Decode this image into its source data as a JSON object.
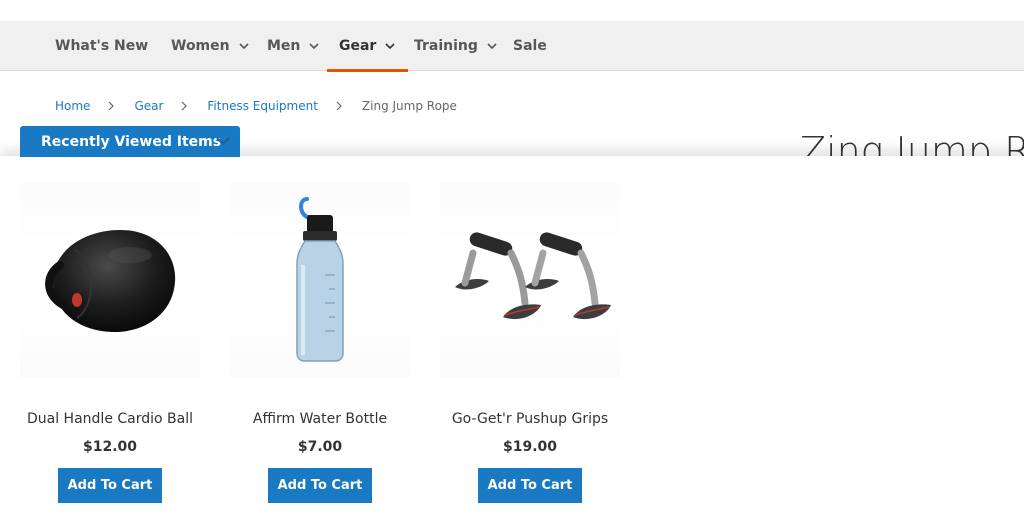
{
  "nav": {
    "items": [
      {
        "label": "What's New",
        "has_dropdown": false,
        "active": false
      },
      {
        "label": "Women",
        "has_dropdown": true,
        "active": false
      },
      {
        "label": "Men",
        "has_dropdown": true,
        "active": false
      },
      {
        "label": "Gear",
        "has_dropdown": true,
        "active": true
      },
      {
        "label": "Training",
        "has_dropdown": true,
        "active": false
      },
      {
        "label": "Sale",
        "has_dropdown": false,
        "active": false
      }
    ]
  },
  "breadcrumbs": [
    "Home",
    "Gear",
    "Fitness Equipment",
    "Zing Jump Rope"
  ],
  "page_title": "Zing Jump Rope",
  "recently_viewed": {
    "tab_label": "Recently Viewed Items",
    "products": [
      {
        "name": "Dual Handle Cardio Ball",
        "price": "$12.00",
        "button": "Add To Cart",
        "icon": "cardio-ball-image"
      },
      {
        "name": "Affirm Water Bottle",
        "price": "$7.00",
        "button": "Add To Cart",
        "icon": "water-bottle-image"
      },
      {
        "name": "Go-Get'r Pushup Grips",
        "price": "$19.00",
        "button": "Add To Cart",
        "icon": "pushup-grips-image"
      }
    ]
  },
  "colors": {
    "accent": "#1979c3",
    "active_underline": "#eb5202",
    "nav_bg": "#f0f0f0"
  }
}
